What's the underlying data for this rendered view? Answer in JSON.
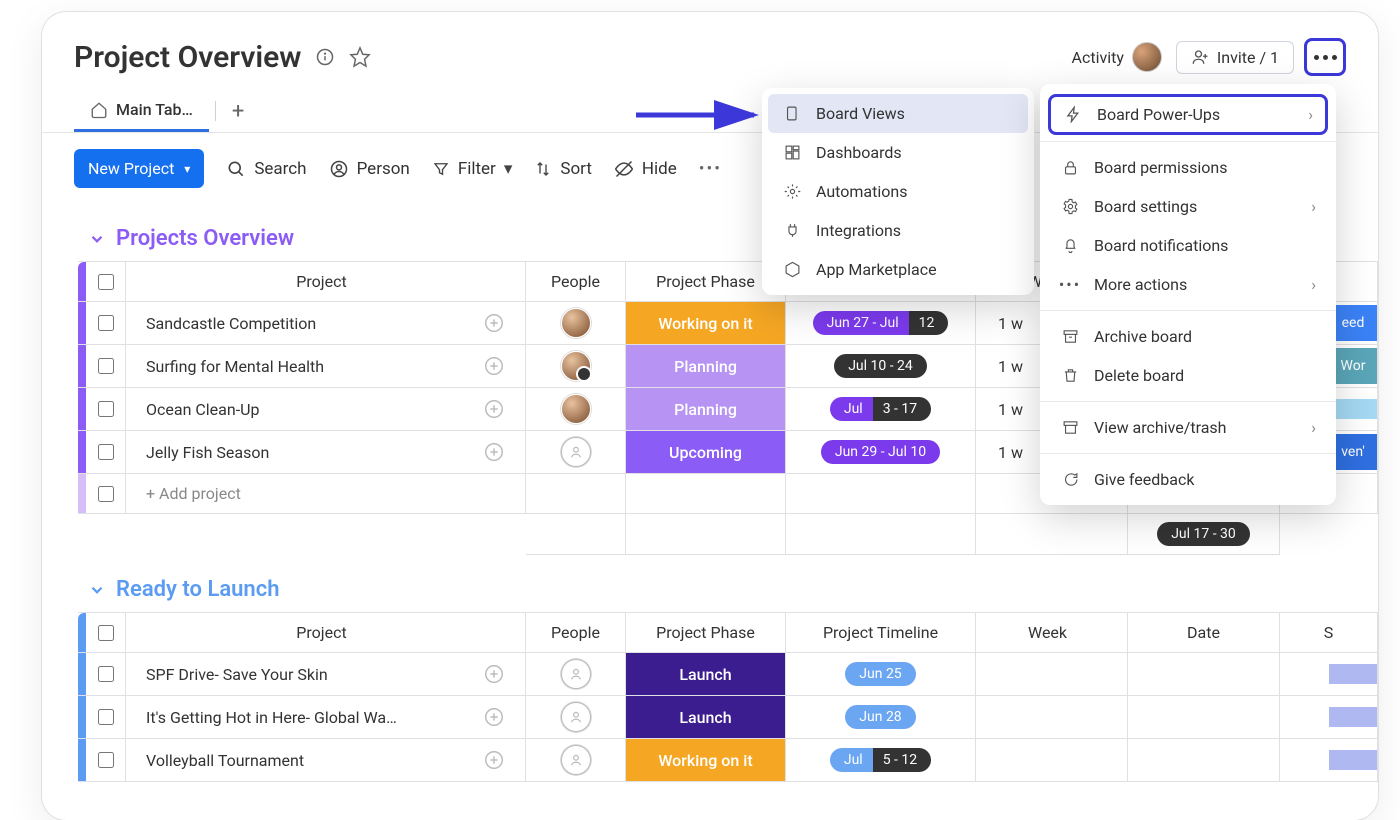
{
  "header": {
    "title": "Project Overview",
    "activity_label": "Activity",
    "invite_label": "Invite / 1"
  },
  "tabs": {
    "main": "Main Tab…"
  },
  "toolbar": {
    "new_project": "New Project",
    "search": "Search",
    "person": "Person",
    "filter": "Filter",
    "sort": "Sort",
    "hide": "Hide"
  },
  "columns": {
    "project": "Project",
    "people": "People",
    "phase": "Project Phase",
    "timeline": "Project Timeline",
    "week": "Week",
    "date": "Date",
    "last": "S"
  },
  "groups": [
    {
      "title": "Projects Overview",
      "color": "purple",
      "add_row": "+ Add project",
      "rows": [
        {
          "name": "Sandcastle Competition",
          "phase": "Working on it",
          "phase_cls": "phase-working",
          "tl_style": "split-purple",
          "tl_l": "Jun 27 - Jul",
          "tl_r": "12",
          "week": "1 w",
          "chip": "eed",
          "chip_cls": "chip-blue1",
          "avatar": "a"
        },
        {
          "name": "Surfing for Mental Health",
          "phase": "Planning",
          "phase_cls": "phase-planning",
          "tl_style": "dark",
          "tl_l": "Jul 10 - 24",
          "tl_r": "",
          "week": "1 w",
          "chip": "Wor",
          "chip_cls": "chip-teal",
          "avatar": "b"
        },
        {
          "name": "Ocean Clean-Up",
          "phase": "Planning",
          "phase_cls": "phase-planning",
          "tl_style": "split-purple",
          "tl_l": "Jul",
          "tl_r": "3 - 17",
          "week": "1 w",
          "chip": "",
          "chip_cls": "chip-sky",
          "avatar": "c"
        },
        {
          "name": "Jelly Fish Season",
          "phase": "Upcoming",
          "phase_cls": "phase-upcoming",
          "tl_style": "purple",
          "tl_l": "Jun 29 - Jul 10",
          "tl_r": "",
          "week": "1 w",
          "chip": "ven'",
          "chip_cls": "chip-blue2",
          "avatar": "none"
        }
      ]
    },
    {
      "title": "Ready to Launch",
      "color": "blue",
      "rows": [
        {
          "name": "SPF Drive- Save Your Skin",
          "phase": "Launch",
          "phase_cls": "phase-launch",
          "tl_style": "blue",
          "tl_l": "Jun 25",
          "tl_r": "",
          "week": "",
          "chip": "",
          "chip_cls": "chip-lav",
          "avatar": "none"
        },
        {
          "name": "It's Getting Hot in Here- Global Wa…",
          "phase": "Launch",
          "phase_cls": "phase-launch",
          "tl_style": "blue",
          "tl_l": "Jun 28",
          "tl_r": "",
          "week": "",
          "chip": "",
          "chip_cls": "chip-lav",
          "avatar": "none"
        },
        {
          "name": "Volleyball Tournament",
          "phase": "Working on it",
          "phase_cls": "phase-working",
          "tl_style": "split-blue",
          "tl_l": "Jul",
          "tl_r": "5 - 12",
          "week": "",
          "chip": "",
          "chip_cls": "chip-lav",
          "avatar": "none"
        }
      ]
    }
  ],
  "loose_pill": "Jul 17 - 30",
  "menu_left": [
    {
      "label": "Board Views",
      "highlight": true
    },
    {
      "label": "Dashboards"
    },
    {
      "label": "Automations"
    },
    {
      "label": "Integrations"
    },
    {
      "label": "App Marketplace"
    }
  ],
  "menu_right": [
    {
      "label": "Board Power-Ups",
      "boxed": true,
      "chev": true,
      "sep_after": true
    },
    {
      "label": "Board permissions"
    },
    {
      "label": "Board settings",
      "chev": true
    },
    {
      "label": "Board notifications"
    },
    {
      "label": "More actions",
      "chev": true,
      "sep_after": true
    },
    {
      "label": "Archive board"
    },
    {
      "label": "Delete board",
      "sep_after": true
    },
    {
      "label": "View archive/trash",
      "chev": true,
      "sep_after": true
    },
    {
      "label": "Give feedback"
    }
  ]
}
